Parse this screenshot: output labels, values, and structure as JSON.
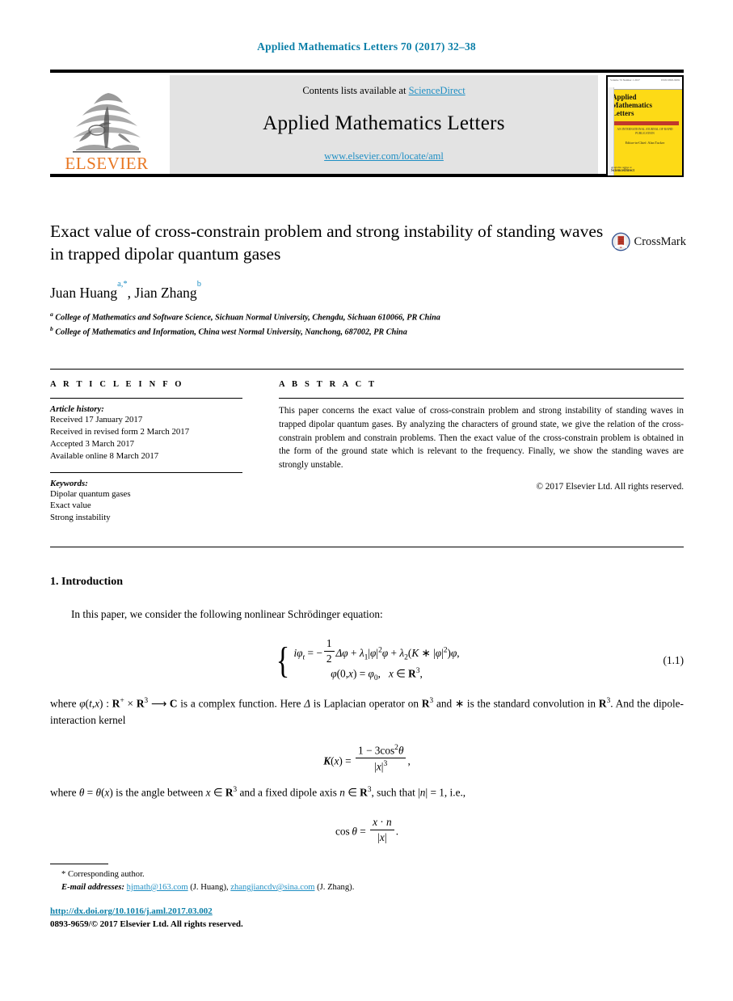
{
  "running_head": "Applied Mathematics Letters 70 (2017) 32–38",
  "masthead": {
    "contents_prefix": "Contents lists available at ",
    "sciencedirect": "ScienceDirect",
    "journal_name": "Applied Mathematics Letters",
    "journal_url": "www.elsevier.com/locate/aml",
    "publisher_wordmark": "ELSEVIER",
    "publisher_logo_icon": "elsevier-tree-icon",
    "cover": {
      "volume_line_left": "Volume 70  Number 1  2017",
      "volume_line_right": "ISSN 0893-9659",
      "title_lines": [
        "Applied",
        "Mathematics",
        "Letters"
      ],
      "redbar_text": "AN INTERNATIONAL JOURNAL OF RAPID PUBLICATION",
      "editor_line": "Editor-in-Chief:  Alan Tucker",
      "footer_small": "Available online at",
      "footer_brand": "ScienceDirect"
    }
  },
  "article": {
    "title": "Exact value of cross-constrain problem and strong instability of standing waves in trapped dipolar quantum gases",
    "crossmark_label": "CrossMark",
    "crossmark_icon": "crossmark-icon",
    "authors_html": "Juan Huang<sup>a,*</sup>, Jian Zhang<sup>b</sup>",
    "affiliations": [
      "College of Mathematics and Software Science, Sichuan Normal University, Chengdu, Sichuan 610066, PR China",
      "College of Mathematics and Information, China west Normal University, Nanchong, 687002, PR China"
    ],
    "affiliation_markers": [
      "a",
      "b"
    ]
  },
  "info": {
    "heading": "A R T I C L E    I N F O",
    "history_label": "Article history:",
    "history": [
      "Received 17 January 2017",
      "Received in revised form 2 March 2017",
      "Accepted 3 March 2017",
      "Available online 8 March 2017"
    ],
    "keywords_label": "Keywords:",
    "keywords": [
      "Dipolar quantum gases",
      "Exact value",
      "Strong instability"
    ]
  },
  "abstract": {
    "heading": "A B S T R A C T",
    "text": "This paper concerns the exact value of cross-constrain problem and strong instability of standing waves in trapped dipolar quantum gases. By analyzing the characters of ground state, we give the relation of the cross-constrain problem and constrain problems. Then the exact value of the cross-constrain problem is obtained in the form of the ground state which is relevant to the frequency. Finally, we show the standing waves are strongly unstable.",
    "copyright": "© 2017 Elsevier Ltd. All rights reserved."
  },
  "body": {
    "section_1_heading": "1. Introduction",
    "para_1": "In this paper, we consider the following nonlinear Schrödinger equation:",
    "eq_1_1": {
      "line_1": "iφ_t = −1/2 Δφ + λ₁|φ|²φ + λ₂(K ∗ |φ|²)φ,",
      "line_2": "φ(0, x) = φ₀,   x ∈ ℝ³,",
      "number": "(1.1)"
    },
    "para_2_a": "where ",
    "para_2_b": " is a complex function. Here Δ is Laplacian operator on ℝ³ and ∗ is the standard convolution in ℝ³. And the dipole-interaction kernel",
    "eq_kernel": "K(x) = (1 − 3cos²θ)/|x|³,",
    "para_3": "where θ = θ(x) is the angle between x ∈ ℝ³ and a fixed dipole axis n ∈ ℝ³, such that |n| = 1, i.e.,",
    "eq_cos": "cos θ = (x · n)/|x|."
  },
  "footnotes": {
    "corresponding": "* Corresponding author.",
    "email_label": "E-mail addresses:",
    "emails": [
      {
        "address": "hjmath@163.com",
        "name": "(J. Huang)"
      },
      {
        "address": "zhangjiancdv@sina.com",
        "name": "(J. Zhang)"
      }
    ],
    "doi": "http://dx.doi.org/10.1016/j.aml.2017.03.002",
    "issn_line": "0893-9659/© 2017 Elsevier Ltd. All rights reserved."
  },
  "colors": {
    "link": "#1f8fc4",
    "runhead": "#0b7fa8",
    "elsevier_orange": "#E87722",
    "cover_yellow": "#fdda16",
    "banner_gray": "#e3e3e3"
  }
}
